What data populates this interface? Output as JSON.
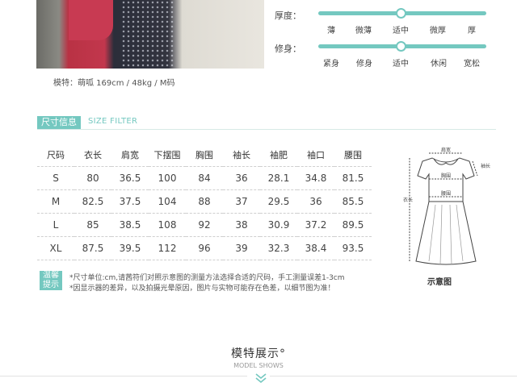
{
  "model": {
    "caption": "模特：萌呱   169cm / 48kg / M码"
  },
  "sliders": [
    {
      "label": "厚度：",
      "options": [
        "薄",
        "微薄",
        "适中",
        "微厚",
        "厚"
      ],
      "selected": 2
    },
    {
      "label": "修身：",
      "options": [
        "紧身",
        "修身",
        "适中",
        "休闲",
        "宽松"
      ],
      "selected": 2
    }
  ],
  "size_section": {
    "tag": "尺寸信息",
    "en": "SIZE FILTER"
  },
  "size_table": {
    "headers": [
      "尺码",
      "衣长",
      "肩宽",
      "下摆围",
      "胸围",
      "袖长",
      "袖肥",
      "袖口",
      "腰围"
    ],
    "rows": [
      [
        "S",
        "80",
        "36.5",
        "100",
        "84",
        "36",
        "28.1",
        "34.8",
        "81.5"
      ],
      [
        "M",
        "82.5",
        "37.5",
        "104",
        "88",
        "37",
        "29.5",
        "36",
        "85.5"
      ],
      [
        "L",
        "85",
        "38.5",
        "108",
        "92",
        "38",
        "30.9",
        "37.2",
        "89.5"
      ],
      [
        "XL",
        "87.5",
        "39.5",
        "112",
        "96",
        "39",
        "32.3",
        "38.4",
        "93.5"
      ]
    ]
  },
  "diagram": {
    "labels": {
      "shoulder": "肩宽",
      "chest": "胸围",
      "waist": "腰围",
      "sleeve": "袖长",
      "length": "衣长"
    },
    "caption": "示意图"
  },
  "notes": {
    "tag_line1": "温馨",
    "tag_line2": "提示",
    "line1": "*尺寸单位:cm,请茜符们对照示意图的测量方法选择合适的尺码，手工测量误差1-3cm",
    "line2": "*因显示器的差异，以及拍摄光晕原因，图片与实物可能存在色差，以细节图为准！"
  },
  "model_show": {
    "title": "模特展示°",
    "subtitle": "MODEL SHOWS"
  },
  "colors": {
    "accent": "#74c8c0"
  }
}
